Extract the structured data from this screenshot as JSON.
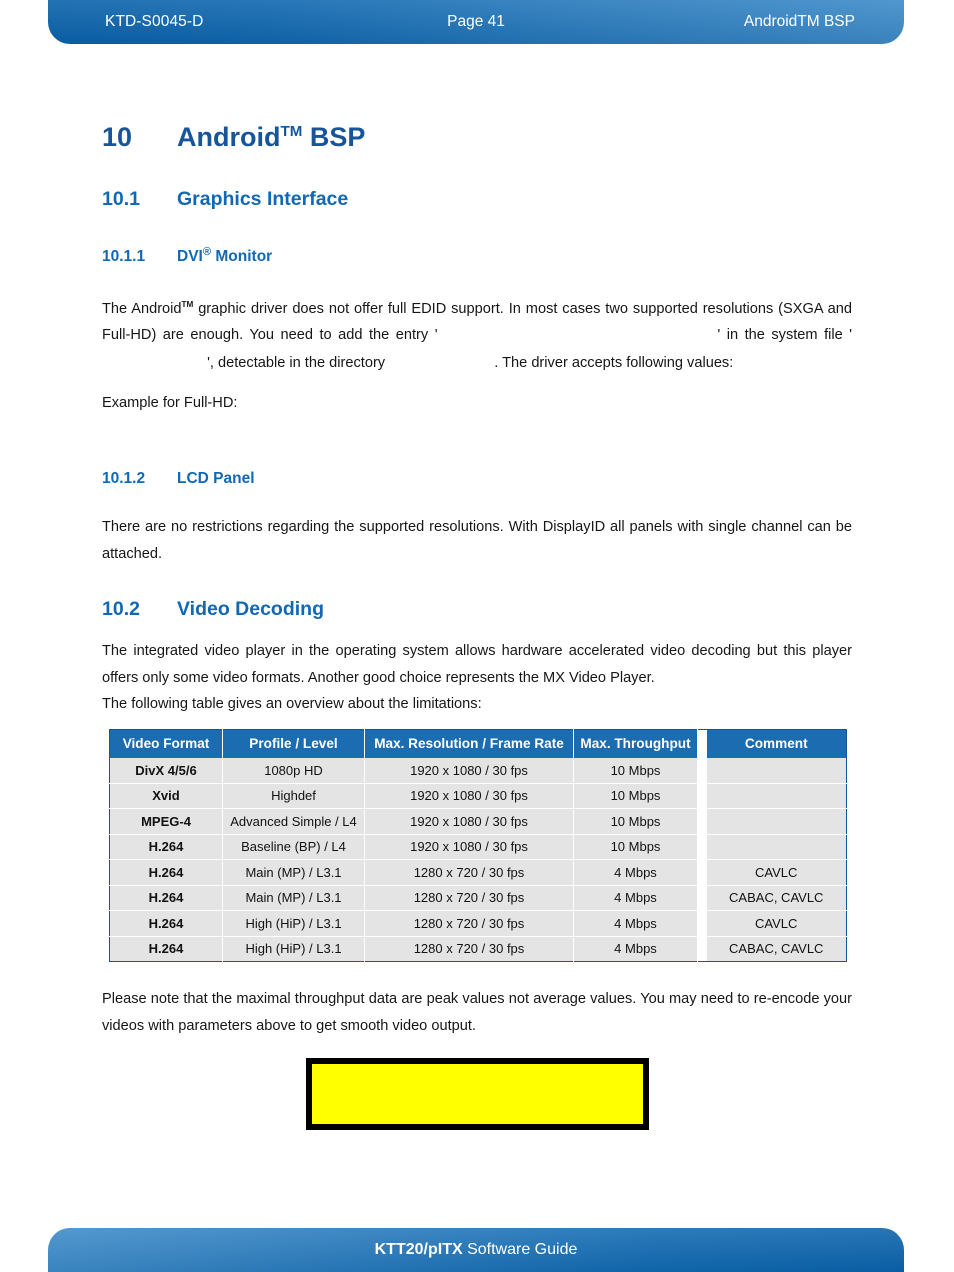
{
  "header": {
    "doc_id": "KTD-S0045-D",
    "page_label": "Page 41",
    "section_title": "AndroidTM BSP"
  },
  "footer": {
    "product": "KTT20/pITX",
    "suffix": " Software Guide"
  },
  "chapter": {
    "number": "10",
    "title_main": "Android",
    "title_sup": "TM",
    "title_tail": " BSP"
  },
  "sections": {
    "graphics": {
      "number": "10.1",
      "title": "Graphics Interface"
    },
    "dvi": {
      "number": "10.1.1",
      "title_main": "DVI",
      "title_sup": "®",
      "title_tail": " Monitor",
      "para_1": "The Android",
      "para_1_sup": "TM",
      "para_2": " graphic driver does not offer full EDID support. In most cases two supported resolutions (SXGA and Full-HD) are enough. You need to add the entry '",
      "hidden_code_1": "                         ",
      "para_3": "' in the system file '",
      "hidden_code_2": "            ",
      "para_4": "', detectable in the directory ",
      "hidden_code_3": "            ",
      "para_5": ". The driver accepts following values:",
      "example_label": "Example for Full-HD:"
    },
    "lcd": {
      "number": "10.1.2",
      "title": "LCD Panel",
      "para": "There are no restrictions regarding the supported resolutions. With DisplayID all panels with single channel can be attached."
    },
    "video": {
      "number": "10.2",
      "title": "Video Decoding",
      "para_line_1": "The integrated video player in the operating system allows hardware accelerated video decoding but this player offers only some video formats. Another good choice represents the MX Video Player.",
      "para_line_2": "The following table gives an overview about the limitations:",
      "note": "Please note that the maximal throughput data are peak values not average values. You may need to re-encode your videos with parameters above to get smooth video output."
    }
  },
  "table": {
    "columns": [
      "Video Format",
      "Profile / Level",
      "Max. Resolution / Frame Rate",
      "Max. Throughput",
      "Comment"
    ],
    "rows": [
      {
        "format": "DivX 4/5/6",
        "profile": "1080p HD",
        "resolution": "1920 x 1080 / 30 fps",
        "throughput": "10 Mbps",
        "comment": ""
      },
      {
        "format": "Xvid",
        "profile": "Highdef",
        "resolution": "1920 x 1080 / 30 fps",
        "throughput": "10 Mbps",
        "comment": ""
      },
      {
        "format": "MPEG-4",
        "profile": "Advanced Simple / L4",
        "resolution": "1920 x 1080 / 30 fps",
        "throughput": "10 Mbps",
        "comment": ""
      },
      {
        "format": "H.264",
        "profile": "Baseline (BP) / L4",
        "resolution": "1920 x 1080 / 30 fps",
        "throughput": "10 Mbps",
        "comment": ""
      },
      {
        "format": "H.264",
        "profile": "Main (MP) / L3.1",
        "resolution": "1280 x 720 / 30 fps",
        "throughput": "4 Mbps",
        "comment": "CAVLC"
      },
      {
        "format": "H.264",
        "profile": "Main (MP) / L3.1",
        "resolution": "1280 x 720 / 30 fps",
        "throughput": "4 Mbps",
        "comment": "CABAC, CAVLC"
      },
      {
        "format": "H.264",
        "profile": "High (HiP) / L3.1",
        "resolution": "1280 x 720 / 30 fps",
        "throughput": "4 Mbps",
        "comment": "CAVLC"
      },
      {
        "format": "H.264",
        "profile": "High (HiP) / L3.1",
        "resolution": "1280 x 720 / 30 fps",
        "throughput": "4 Mbps",
        "comment": "CABAC, CAVLC"
      }
    ]
  },
  "code_box": {
    "content": "",
    "fill_color": "#ffff00",
    "border_color": "#000000"
  },
  "colors": {
    "heading_blue": "#16559a",
    "section_blue": "#1168b5",
    "band_blue_dark": "#0a62ab",
    "band_blue_light": "#3d8bc9",
    "table_header_blue": "#1b6cb0",
    "table_cell_gray": "#e4e4e4"
  }
}
